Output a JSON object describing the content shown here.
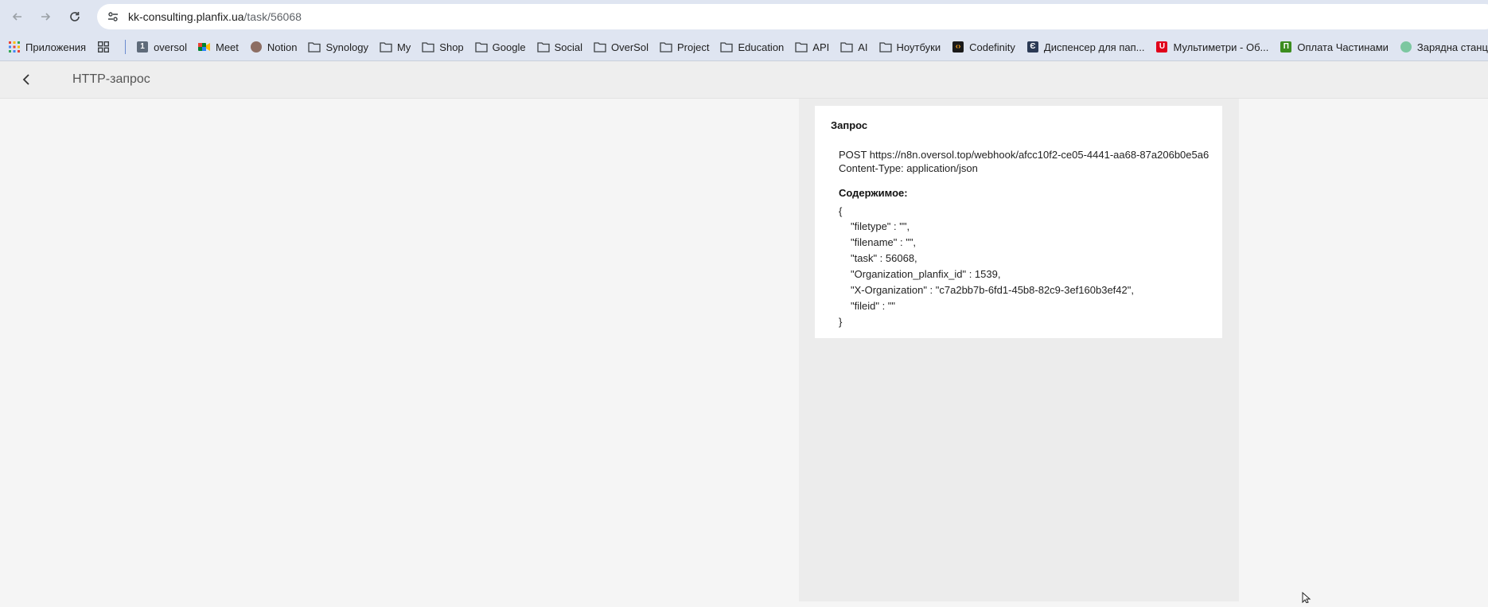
{
  "browser": {
    "url_host": "kk-consulting.planfix.ua",
    "url_path": "/task/56068"
  },
  "bookmarks": [
    {
      "label": "Приложения",
      "icon": "apps-grid-icon"
    },
    {
      "label": "",
      "icon": "tab-groups-icon"
    },
    {
      "label": "oversol",
      "icon": "oversol-favicon"
    },
    {
      "label": "Meet",
      "icon": "meet-favicon"
    },
    {
      "label": "Notion",
      "icon": "notion-favicon"
    },
    {
      "label": "Synology",
      "icon": "folder-icon"
    },
    {
      "label": "My",
      "icon": "folder-icon"
    },
    {
      "label": "Shop",
      "icon": "folder-icon"
    },
    {
      "label": "Google",
      "icon": "folder-icon"
    },
    {
      "label": "Social",
      "icon": "folder-icon"
    },
    {
      "label": "OverSol",
      "icon": "folder-icon"
    },
    {
      "label": "Project",
      "icon": "folder-icon"
    },
    {
      "label": "Education",
      "icon": "folder-icon"
    },
    {
      "label": "API",
      "icon": "folder-icon"
    },
    {
      "label": "AI",
      "icon": "folder-icon"
    },
    {
      "label": "Ноутбуки",
      "icon": "folder-icon"
    },
    {
      "label": "Codefinity",
      "icon": "codefinity-favicon"
    },
    {
      "label": "Диспенсер для пап...",
      "icon": "dispenser-favicon"
    },
    {
      "label": "Мультиметри - Об...",
      "icon": "multimeter-favicon"
    },
    {
      "label": "Оплата Частинами",
      "icon": "payment-favicon"
    },
    {
      "label": "Зарядна станці",
      "icon": "charging-favicon"
    }
  ],
  "header": {
    "title": "HTTP-запрос"
  },
  "request": {
    "heading": "Запрос",
    "method_url": "POST https://n8n.oversol.top/webhook/afcc10f2-ce05-4441-aa68-87a206b0e5a6",
    "content_type": "Content-Type: application/json",
    "body_label": "Содержимое:",
    "body_lines": [
      "{",
      "\"filetype\" : \"\",",
      "\"filename\" : \"\",",
      "\"task\" : 56068,",
      "\"Organization_planfix_id\" : 1539,",
      "\"X-Organization\" : \"c7a2bb7b-6fd1-45b8-82c9-3ef160b3ef42\",",
      "\"fileid\" : \"\"",
      "}"
    ]
  },
  "colors": {
    "browser_chrome": "#dfe5f1",
    "app_header": "#eeeeee",
    "panel": "#ececec",
    "card": "#ffffff"
  }
}
